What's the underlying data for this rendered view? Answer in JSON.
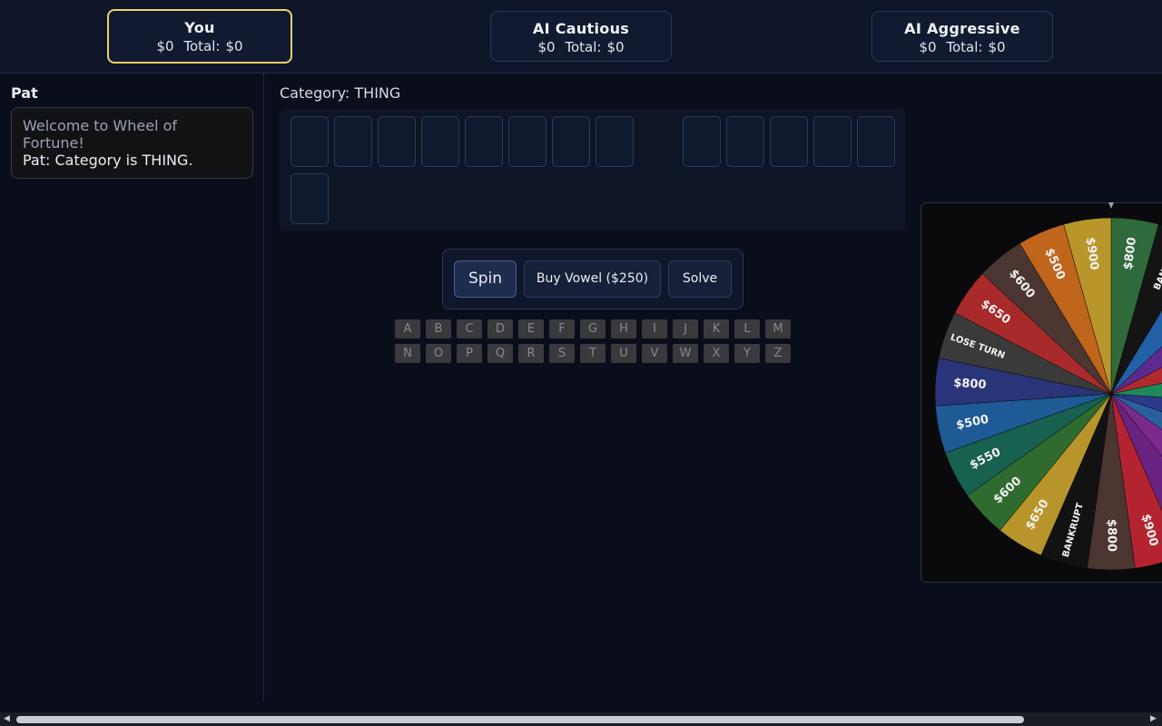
{
  "players": [
    {
      "name": "You",
      "round": "$0",
      "total_label": "Total:",
      "total": "$0",
      "active": true
    },
    {
      "name": "AI Cautious",
      "round": "$0",
      "total_label": "Total:",
      "total": "$0",
      "active": false
    },
    {
      "name": "AI Aggressive",
      "round": "$0",
      "total_label": "Total:",
      "total": "$0",
      "active": false
    }
  ],
  "host": {
    "name": "Pat",
    "messages": [
      "Welcome to Wheel of Fortune!",
      "Pat: Category is THING."
    ]
  },
  "puzzle": {
    "category_label": "Category: THING",
    "rows": [
      [
        8,
        5
      ],
      [
        1
      ]
    ]
  },
  "controls": {
    "spin_label": "Spin",
    "buy_vowel_label": "Buy Vowel ($250)",
    "solve_label": "Solve"
  },
  "letters": [
    "A",
    "B",
    "C",
    "D",
    "E",
    "F",
    "G",
    "H",
    "I",
    "J",
    "K",
    "L",
    "M",
    "N",
    "O",
    "P",
    "Q",
    "R",
    "S",
    "T",
    "U",
    "V",
    "W",
    "X",
    "Y",
    "Z"
  ],
  "wheel": {
    "wedges": [
      {
        "label": "$800",
        "color": "#2f6b3a"
      },
      {
        "label": "BANKRUPT",
        "color": "#141414"
      },
      {
        "label": "$500",
        "color": "#2360a8"
      },
      {
        "label": "$600",
        "color": "#5b2a8c"
      },
      {
        "label": "$650",
        "color": "#b02a2e"
      },
      {
        "label": "$700",
        "color": "#1e8a5a"
      },
      {
        "label": "$800",
        "color": "#2b3a8a"
      },
      {
        "label": "$550",
        "color": "#2a5f9e"
      },
      {
        "label": "$600",
        "color": "#7a2a8a"
      },
      {
        "label": "$900",
        "color": "#6a2380"
      },
      {
        "label": "$900",
        "color": "#b42430"
      },
      {
        "label": "$800",
        "color": "#4a3530"
      },
      {
        "label": "BANKRUPT",
        "color": "#121212"
      },
      {
        "label": "$650",
        "color": "#b8952a"
      },
      {
        "label": "$600",
        "color": "#2f6b2e"
      },
      {
        "label": "$550",
        "color": "#186050"
      },
      {
        "label": "$500",
        "color": "#1e5a96"
      },
      {
        "label": "$800",
        "color": "#2a3478"
      },
      {
        "label": "LOSE TURN",
        "color": "#3a3a3a"
      },
      {
        "label": "$650",
        "color": "#a82a2a"
      },
      {
        "label": "$600",
        "color": "#4a3530"
      },
      {
        "label": "$500",
        "color": "#c0651c"
      },
      {
        "label": "$900",
        "color": "#b8962a"
      }
    ]
  }
}
